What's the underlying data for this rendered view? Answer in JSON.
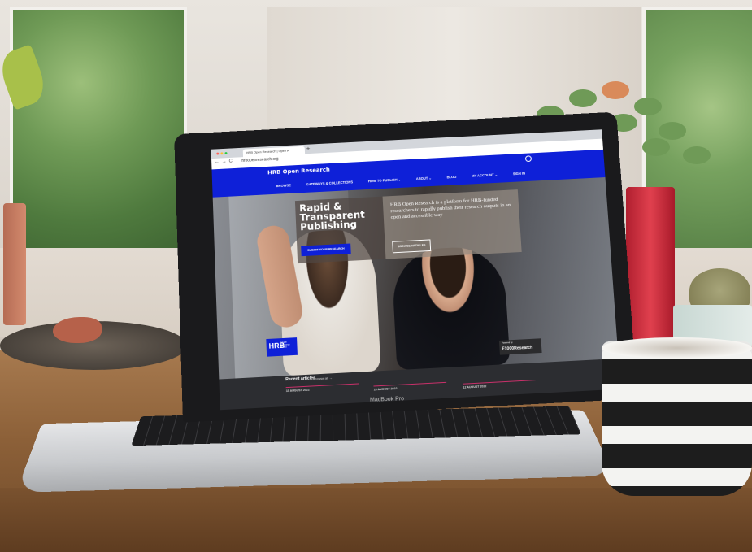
{
  "browser": {
    "tab_title": "HRB Open Research | Open A",
    "new_tab": "+",
    "url": "hrbopenresearch.org"
  },
  "site": {
    "brand": "HRB Open Research",
    "nav": [
      "BROWSE",
      "GATEWAYS & COLLECTIONS",
      "HOW TO PUBLISH ⌄",
      "ABOUT ⌄",
      "BLOG",
      "MY ACCOUNT ⌄",
      "SIGN IN"
    ]
  },
  "hero": {
    "headline": "Rapid & Transparent Publishing",
    "submit_label": "SUBMIT YOUR RESEARCH",
    "description": "HRB Open Research is a platform for HRB-funded researchers to rapidly publish their research outputs in an open and accessible way",
    "browse_label": "BROWSE ARTICLES"
  },
  "logos": {
    "hrb_mark": "HRB",
    "hrb_text": "Health Research Board",
    "powered_by": "Powered by",
    "f1000": "F1000Research"
  },
  "recent": {
    "title": "Recent articles",
    "browse_all": "Browse all →",
    "dates": [
      "15 AUGUST 2022",
      "15 AUGUST 2022",
      "12 AUGUST 2022"
    ]
  },
  "device": {
    "label": "MacBook Pro"
  }
}
